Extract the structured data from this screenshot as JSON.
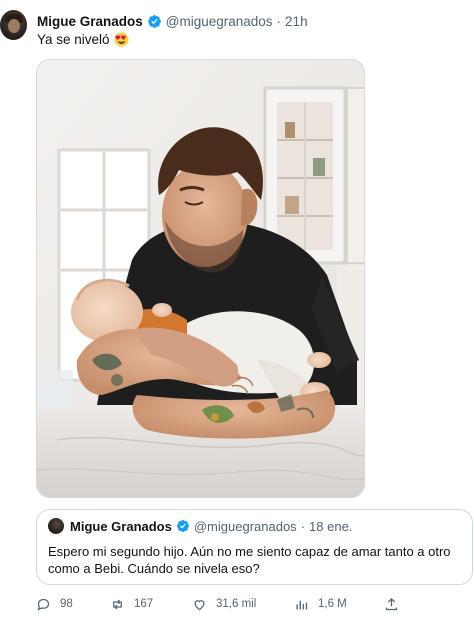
{
  "tweet": {
    "author_name": "Migue Granados",
    "handle": "@miguegranados",
    "separator": "·",
    "time": "21h",
    "text": "Ya se niveló",
    "emoji_icon": "smiling-face-with-heart-eyes-icon"
  },
  "quoted_tweet": {
    "author_name": "Migue Granados",
    "handle": "@miguegranados",
    "separator": "·",
    "date": "18 ene.",
    "text": "Espero mi segundo hijo. Aún no me siento capaz de amar tanto a otro como a Bebi. Cuándo se nivela eso?"
  },
  "actions": {
    "replies": "98",
    "retweets": "167",
    "likes": "31,6 mil",
    "views": "1,6 M"
  },
  "colors": {
    "verified_blue": "#1d9bf0",
    "secondary_text": "#536471",
    "border": "#cfd9de"
  }
}
